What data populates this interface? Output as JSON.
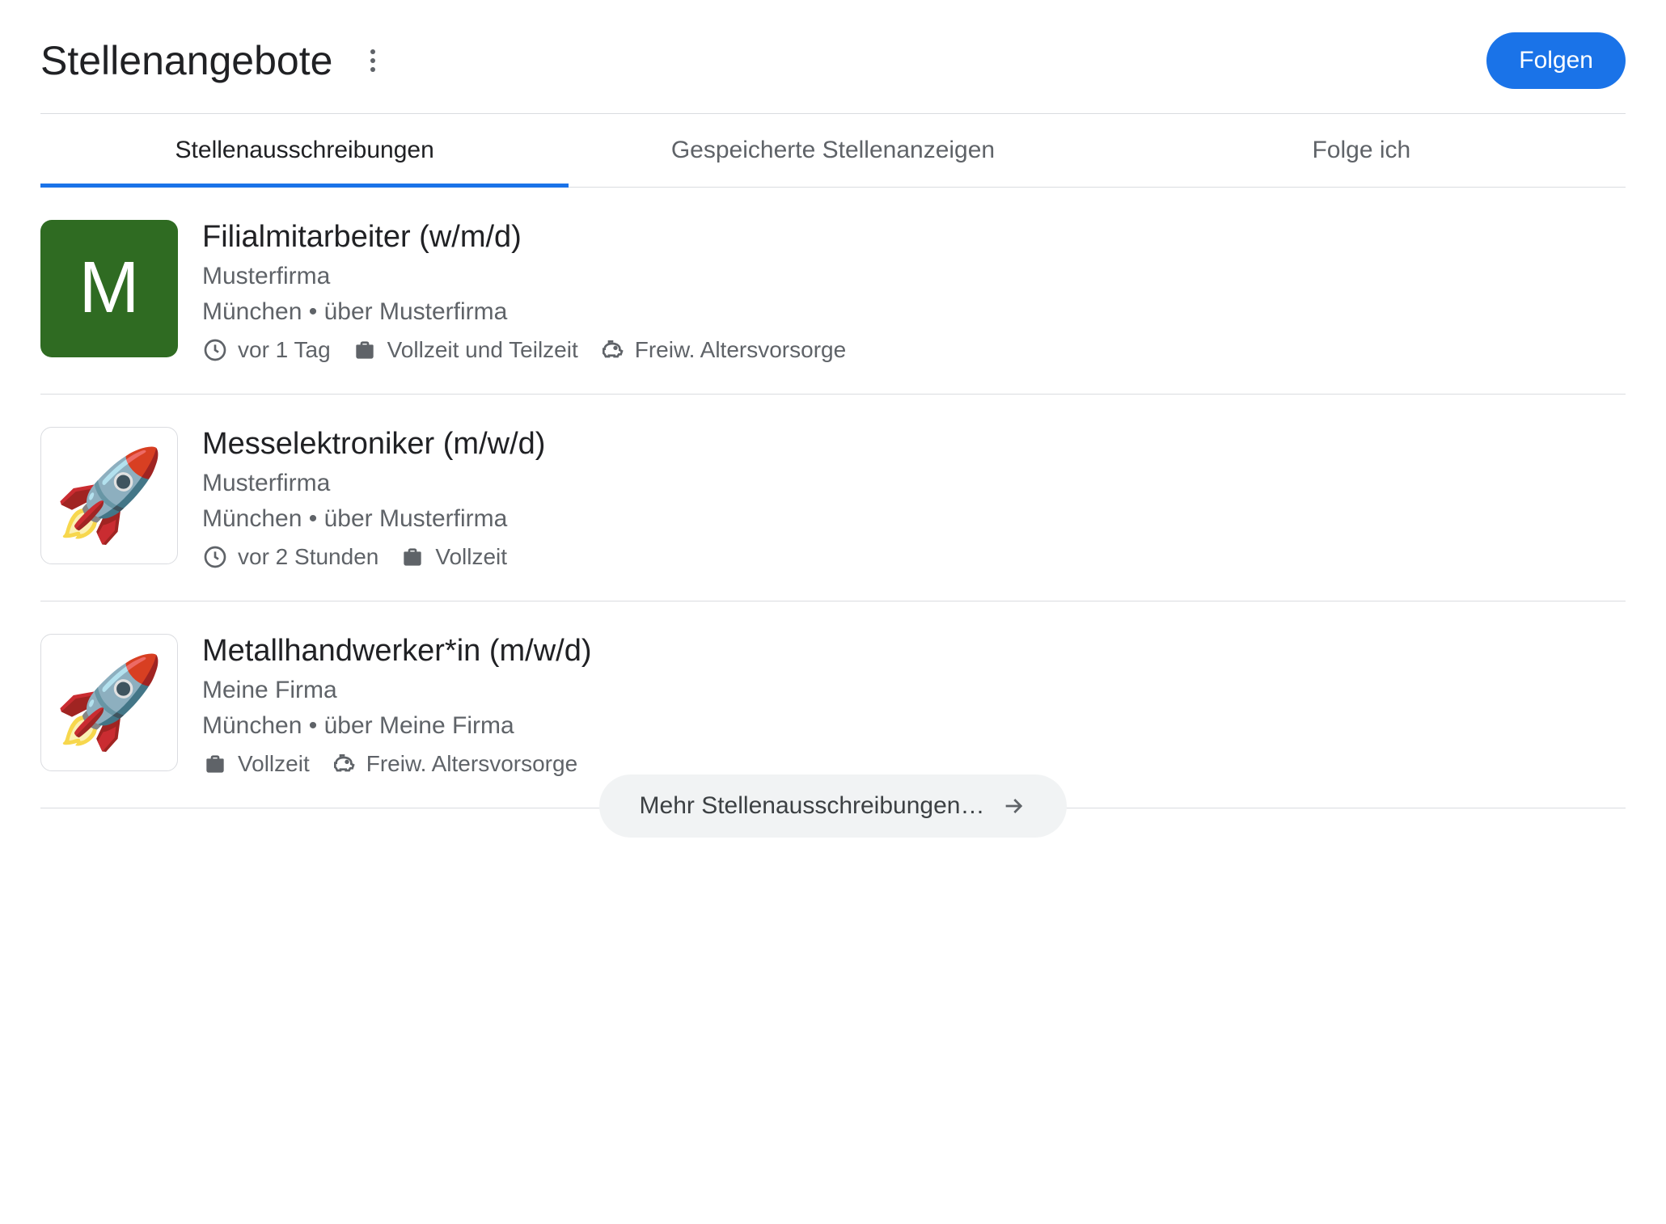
{
  "header": {
    "title": "Stellenangebote",
    "follow_label": "Folgen"
  },
  "tabs": [
    {
      "label": "Stellenausschreibungen",
      "active": true
    },
    {
      "label": "Gespeicherte Stellenanzeigen",
      "active": false
    },
    {
      "label": "Folge ich",
      "active": false
    }
  ],
  "listings": [
    {
      "logo_type": "letter",
      "logo_letter": "M",
      "title": "Filialmitarbeiter (w/m/d)",
      "company": "Musterfirma",
      "location": "München • über Musterfirma",
      "meta": [
        {
          "icon": "clock",
          "text": "vor 1 Tag"
        },
        {
          "icon": "briefcase",
          "text": "Vollzeit und Teilzeit"
        },
        {
          "icon": "piggy",
          "text": "Freiw. Altersvorsorge"
        }
      ]
    },
    {
      "logo_type": "rocket",
      "title": "Messelektroniker (m/w/d)",
      "company": "Musterfirma",
      "location": "München • über Musterfirma",
      "meta": [
        {
          "icon": "clock",
          "text": "vor 2 Stunden"
        },
        {
          "icon": "briefcase",
          "text": "Vollzeit"
        }
      ]
    },
    {
      "logo_type": "rocket",
      "title": "Metallhandwerker*in (m/w/d)",
      "company": "Meine Firma",
      "location": "München • über Meine Firma",
      "meta": [
        {
          "icon": "briefcase",
          "text": "Vollzeit"
        },
        {
          "icon": "piggy",
          "text": "Freiw. Altersvorsorge"
        }
      ]
    }
  ],
  "more_button": "Mehr Stellenausschreibungen…"
}
